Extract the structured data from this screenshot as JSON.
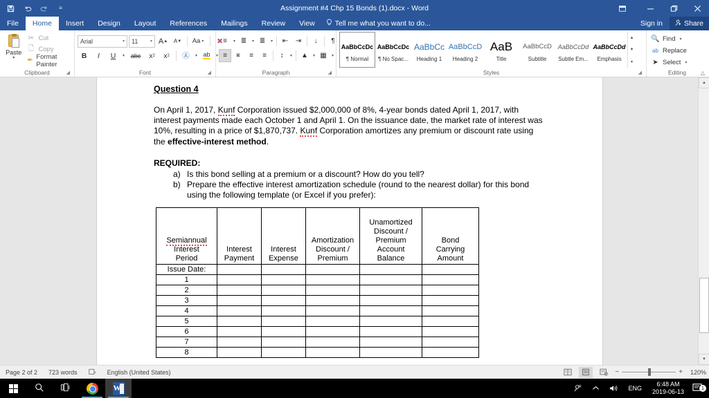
{
  "titlebar": {
    "document_title": "Assignment #4 Chp 15 Bonds (1).docx - Word",
    "qat": [
      {
        "name": "save",
        "glyph": "ὋE"
      },
      {
        "name": "undo",
        "glyph": "↶"
      },
      {
        "name": "redo",
        "glyph": "↷"
      },
      {
        "name": "customize",
        "glyph": "≡"
      }
    ],
    "ribbon_display_options": "⬚",
    "minimize": "─",
    "restore": "❐",
    "close": "✕"
  },
  "tabs": [
    {
      "label": "File",
      "active": false
    },
    {
      "label": "Home",
      "active": true
    },
    {
      "label": "Insert",
      "active": false
    },
    {
      "label": "Design",
      "active": false
    },
    {
      "label": "Layout",
      "active": false
    },
    {
      "label": "References",
      "active": false
    },
    {
      "label": "Mailings",
      "active": false
    },
    {
      "label": "Review",
      "active": false
    },
    {
      "label": "View",
      "active": false
    }
  ],
  "tellme": {
    "icon": "⚡",
    "text": "Tell me what you want to do..."
  },
  "account": {
    "signin": "Sign in",
    "share": "Share",
    "share_icon": "☺"
  },
  "ribbon": {
    "clipboard": {
      "label": "Clipboard",
      "paste": "Paste",
      "cut": "Cut",
      "copy": "Copy",
      "format_painter": "Format Painter"
    },
    "font": {
      "label": "Font",
      "font_name": "Arial",
      "font_size": "11",
      "grow_font": "A",
      "shrink_font": "A",
      "change_case": "Aa",
      "clear_formatting": "✐",
      "bold": "B",
      "italic": "I",
      "underline": "U",
      "strikethrough": "abc",
      "subscript": "x",
      "superscript": "x",
      "text_effects": "A",
      "text_highlight": "ab",
      "font_color": "A"
    },
    "paragraph": {
      "label": "Paragraph",
      "bullets": "☰",
      "numbering": "☷",
      "multilevel_list": "☵",
      "decrease_indent": "←",
      "increase_indent": "→",
      "sort": "↕",
      "show_marks": "¶",
      "align_left": "☰",
      "align_center": "☰",
      "align_right": "☰",
      "justify": "☰",
      "line_spacing": "↕",
      "shading": "■",
      "borders": "⊞"
    },
    "styles": {
      "label": "Styles",
      "items": [
        {
          "sample": "AaBbCcDc",
          "name": "¶ Normal",
          "selected": true
        },
        {
          "sample": "AaBbCcDc",
          "name": "¶ No Spac...",
          "selected": false
        },
        {
          "sample": "AaBbCc",
          "name": "Heading 1",
          "selected": false
        },
        {
          "sample": "AaBbCcD",
          "name": "Heading 2",
          "selected": false
        },
        {
          "sample": "AaB",
          "name": "Title",
          "selected": false
        },
        {
          "sample": "AaBbCcD",
          "name": "Subtitle",
          "selected": false
        },
        {
          "sample": "AaBbCcDd",
          "name": "Subtle Em...",
          "selected": false
        },
        {
          "sample": "AaBbCcDd",
          "name": "Emphasis",
          "selected": false
        }
      ],
      "scroll_up": "▲",
      "scroll_down": "▼",
      "more": "▾"
    },
    "editing": {
      "label": "Editing",
      "find": "Find",
      "replace": "Replace",
      "select": "Select",
      "find_icon": "⚲",
      "replace_icon": "ab",
      "select_icon": "➤"
    },
    "collapse": "∧"
  },
  "document": {
    "heading": "Question 4",
    "paragraph_parts": [
      {
        "text": "On April 1, 2017, ",
        "style": "normal"
      },
      {
        "text": "Kunf",
        "style": "spell"
      },
      {
        "text": " Corporation issued $2,000,000 of 8%, 4-year bonds dated April 1, 2017, with interest payments made each October 1 and April 1. On the issuance date, the market rate of interest was 10%, resulting in a price of $1,870,737. ",
        "style": "normal"
      },
      {
        "text": "Kunf",
        "style": "spell"
      },
      {
        "text": " Corporation amortizes any premium or discount rate using the ",
        "style": "normal"
      },
      {
        "text": "effective-interest method",
        "style": "bold"
      },
      {
        "text": ".",
        "style": "normal"
      }
    ],
    "required_label": "REQUIRED:",
    "required_items": [
      {
        "marker": "a)",
        "text": "Is this bond selling at a premium or a discount?  How do you tell?"
      },
      {
        "marker": "b)",
        "text": "Prepare the effective interest amortization schedule (round to the nearest dollar) for this bond using the following template (or Excel if you prefer):"
      }
    ],
    "table": {
      "headers": [
        "Semiannual\nInterest\nPeriod",
        "Interest\nPayment",
        "Interest\nExpense",
        "Amortization\nDiscount /\nPremium",
        "Unamortized\nDiscount /\nPremium\nAccount\nBalance",
        "Bond\nCarrying\nAmount"
      ],
      "header_spell_word": "Semiannual",
      "rows": [
        [
          "Issue Date:",
          "",
          "",
          "",
          "",
          ""
        ],
        [
          "1",
          "",
          "",
          "",
          "",
          ""
        ],
        [
          "2",
          "",
          "",
          "",
          "",
          ""
        ],
        [
          "3",
          "",
          "",
          "",
          "",
          ""
        ],
        [
          "4",
          "",
          "",
          "",
          "",
          ""
        ],
        [
          "5",
          "",
          "",
          "",
          "",
          ""
        ],
        [
          "6",
          "",
          "",
          "",
          "",
          ""
        ],
        [
          "7",
          "",
          "",
          "",
          "",
          ""
        ],
        [
          "8",
          "",
          "",
          "",
          "",
          ""
        ]
      ]
    }
  },
  "statusbar": {
    "page": "Page 2 of 2",
    "words": "723 words",
    "proofing_icon": "⌨",
    "language": "English (United States)",
    "view_read": "☷",
    "view_print": "▤",
    "view_web": "▧",
    "zoom_out": "−",
    "zoom_in": "+",
    "zoom_level": "120%"
  },
  "taskbar": {
    "start": "start-button",
    "search": "⚲",
    "task_view": "⧉",
    "apps": [
      {
        "name": "chrome",
        "active": true
      },
      {
        "name": "word",
        "active": true
      }
    ],
    "tray": {
      "people": "☺",
      "show_hidden": "∧",
      "volume": "ὐA",
      "language": "ENG",
      "time": "6:48 AM",
      "date": "2019-06-13",
      "notifications": "✉",
      "notification_count": "1"
    }
  }
}
